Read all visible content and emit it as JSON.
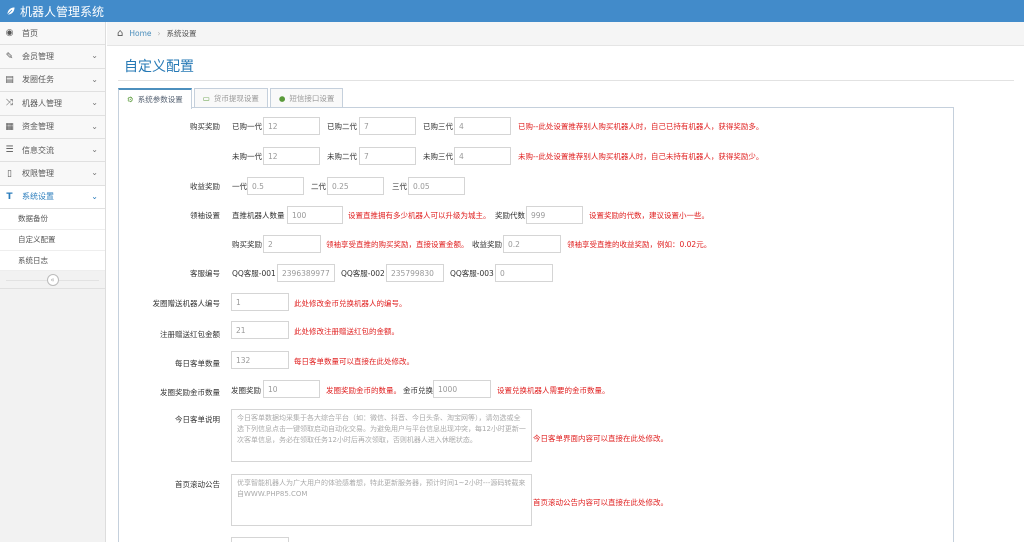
{
  "app": {
    "title": "机器人管理系统"
  },
  "sidebar": {
    "items": [
      {
        "label": "首页",
        "icon": "dashboard-icon"
      },
      {
        "label": "会员管理",
        "icon": "edit-icon"
      },
      {
        "label": "发圈任务",
        "icon": "book-icon"
      },
      {
        "label": "机器人管理",
        "icon": "shuffle-icon"
      },
      {
        "label": "资金管理",
        "icon": "calendar-icon"
      },
      {
        "label": "信息交流",
        "icon": "list-icon"
      },
      {
        "label": "权限管理",
        "icon": "file-icon"
      },
      {
        "label": "系统设置",
        "icon": "text-icon"
      }
    ],
    "subitems": [
      "数据备份",
      "自定义配置",
      "系统日志"
    ],
    "collapse_glyph": "«"
  },
  "breadcrumb": {
    "home": "Home",
    "current": "系统设置"
  },
  "page": {
    "title": "自定义配置"
  },
  "tabs": [
    "系统参数设置",
    "货币提现设置",
    "短信接口设置"
  ],
  "form": {
    "purchase_reward": {
      "label": "购买奖励",
      "bought": {
        "l1": "已购一代",
        "v1": "12",
        "l2": "已购二代",
        "v2": "7",
        "l3": "已购三代",
        "v3": "4",
        "note": "已购--此处设置推荐别人购买机器人时，自己已持有机器人，获得奖励多。"
      },
      "unbought": {
        "l1": "未购一代",
        "v1": "12",
        "l2": "未购二代",
        "v2": "7",
        "l3": "未购三代",
        "v3": "4",
        "note": "未购--此处设置推荐别人购买机器人时，自己未持有机器人，获得奖励少。"
      }
    },
    "income_reward": {
      "label": "收益奖励",
      "l1": "一代",
      "v1": "0.5",
      "l2": "二代",
      "v2": "0.25",
      "l3": "三代",
      "v3": "0.05"
    },
    "leader": {
      "label": "领袖设置",
      "robots_label": "直推机器人数量",
      "robots": "100",
      "robots_note": "设置直推拥有多少机器人可以升级为城主。",
      "gen_label": "奖励代数",
      "gen": "999",
      "gen_note": "设置奖励的代数，建议设置小一些。",
      "buy_label": "购买奖励",
      "buy": "2",
      "buy_note": "领袖享受直推的购买奖励，直接设置金额。",
      "inc_label": "收益奖励",
      "inc": "0.2",
      "inc_note": "领袖享受直推的收益奖励，例如：0.02元。"
    },
    "service": {
      "label": "客服编号",
      "l1": "QQ客服-001",
      "v1": "2396389977",
      "l2": "QQ客服-002",
      "v2": "235799830",
      "l3": "QQ客服-003",
      "v3": "0"
    },
    "gift_robot": {
      "label": "发圈赠送机器人编号",
      "value": "1",
      "note": "此处修改金币兑换机器人的编号。"
    },
    "red_packet": {
      "label": "注册赠送红包金额",
      "value": "21",
      "note": "此处修改注册赠送红包的金额。"
    },
    "daily_orders": {
      "label": "每日客单数量",
      "value": "132",
      "note": "每日客单数量可以直接在此处修改。"
    },
    "coins": {
      "label": "发圈奖励金币数量",
      "l1": "发圈奖励",
      "v1": "10",
      "note1": "发圈奖励金币的数量。",
      "l2": "金币兑换",
      "v2": "1000",
      "note2": "设置兑换机器人需要的金币数量。"
    },
    "today_desc": {
      "label": "今日客单说明",
      "text": "今日客单数据均采集于各大综合平台（如：微信、抖音、今日头条、淘宝网等），请勿选或全选下列信息点击一键领取启动自动化交易。为避免用户与平台信息出现冲突，每12小时更新一次客单信息，务必在领取任务12小时后再次领取，否则机器人进入休眠状态。",
      "note": "今日客单界面内容可以直接在此处修改。"
    },
    "notice": {
      "label": "首页滚动公告",
      "text": "优享智能机器人为广大用户的体验感着想，特此更新服务器，预计时间1~2小时---源码转载来自WWW.PHP85.COM",
      "note": "首页滚动公告内容可以直接在此处修改。"
    }
  }
}
